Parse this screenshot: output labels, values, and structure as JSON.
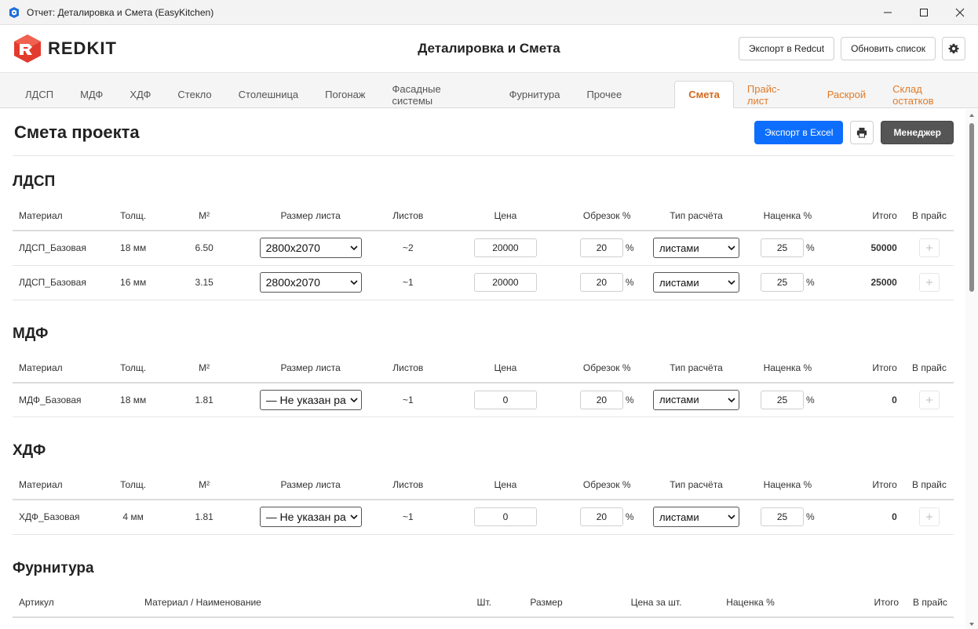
{
  "window": {
    "title": "Отчет: Деталировка и Смета (EasyKitchen)"
  },
  "header": {
    "logo_text": "REDKIT",
    "title": "Деталировка и Смета",
    "export_redcut": "Экспорт в Redcut",
    "refresh": "Обновить список"
  },
  "tabs": [
    {
      "label": "ЛДСП"
    },
    {
      "label": "МДФ"
    },
    {
      "label": "ХДФ"
    },
    {
      "label": "Стекло"
    },
    {
      "label": "Столешница"
    },
    {
      "label": "Погонаж"
    },
    {
      "label": "Фасадные системы"
    },
    {
      "label": "Фурнитура"
    },
    {
      "label": "Прочее"
    },
    {
      "label": "Смета"
    },
    {
      "label": "Прайс-лист"
    },
    {
      "label": "Раскрой"
    },
    {
      "label": "Склад остатков"
    }
  ],
  "page": {
    "title": "Смета проекта",
    "export_excel": "Экспорт в Excel",
    "manager": "Менеджер"
  },
  "columns": {
    "material": "Материал",
    "thickness": "Толщ.",
    "area": "М²",
    "sheet_size": "Размер листа",
    "sheets": "Листов",
    "price": "Цена",
    "waste": "Обрезок %",
    "calc_type": "Тип расчёта",
    "markup": "Наценка %",
    "total": "Итого",
    "to_price": "В прайс",
    "percent": "%"
  },
  "sections": [
    {
      "title": "ЛДСП",
      "rows": [
        {
          "material": "ЛДСП_Базовая",
          "thickness": "18 мм",
          "area": "6.50",
          "sheet_size": "2800x2070",
          "sheets": "~2",
          "price": "20000",
          "waste": "20",
          "calc_type": "листами",
          "markup": "25",
          "total": "50000"
        },
        {
          "material": "ЛДСП_Базовая",
          "thickness": "16 мм",
          "area": "3.15",
          "sheet_size": "2800x2070",
          "sheets": "~1",
          "price": "20000",
          "waste": "20",
          "calc_type": "листами",
          "markup": "25",
          "total": "25000"
        }
      ]
    },
    {
      "title": "МДФ",
      "rows": [
        {
          "material": "МДФ_Базовая",
          "thickness": "18 мм",
          "area": "1.81",
          "sheet_size": "— Не указан ра",
          "sheets": "~1",
          "price": "0",
          "waste": "20",
          "calc_type": "листами",
          "markup": "25",
          "total": "0"
        }
      ]
    },
    {
      "title": "ХДФ",
      "rows": [
        {
          "material": "ХДФ_Базовая",
          "thickness": "4 мм",
          "area": "1.81",
          "sheet_size": "— Не указан ра",
          "sheets": "~1",
          "price": "0",
          "waste": "20",
          "calc_type": "листами",
          "markup": "25",
          "total": "0"
        }
      ]
    }
  ],
  "hardware": {
    "title": "Фурнитура",
    "columns": {
      "article": "Артикул",
      "name": "Материал / Наименование",
      "qty": "Шт.",
      "size": "Размер",
      "unit_price": "Цена за шт.",
      "markup": "Наценка %",
      "total": "Итого",
      "to_price": "В прайс"
    }
  }
}
